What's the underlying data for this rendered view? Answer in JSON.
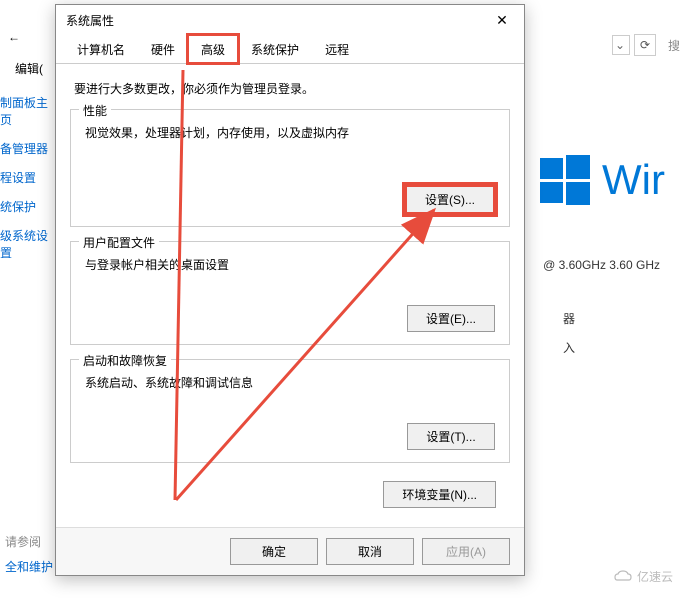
{
  "background": {
    "nav_back": "←",
    "edit_label": "编辑(",
    "sidebar": [
      "制面板主页",
      "备管理器",
      "程设置",
      "统保护",
      "级系统设置"
    ],
    "dropdown_chevron": "⌄",
    "refresh_icon": "⟳",
    "search_placeholder": "搜",
    "windows_text": "Wir",
    "cpu_info": "@ 3.60GHz   3.60 GHz",
    "info_1": "器",
    "info_2": "入",
    "bottom_links": [
      "请参阅",
      "全和维护"
    ],
    "watermark": "亿速云"
  },
  "dialog": {
    "title": "系统属性",
    "close": "✕",
    "tabs": [
      "计算机名",
      "硬件",
      "高级",
      "系统保护",
      "远程"
    ],
    "active_tab_index": 2,
    "intro": "要进行大多数更改，你必须作为管理员登录。",
    "performance": {
      "title": "性能",
      "desc": "视觉效果，处理器计划，内存使用，以及虚拟内存",
      "button": "设置(S)..."
    },
    "userprofile": {
      "title": "用户配置文件",
      "desc": "与登录帐户相关的桌面设置",
      "button": "设置(E)..."
    },
    "startup": {
      "title": "启动和故障恢复",
      "desc": "系统启动、系统故障和调试信息",
      "button": "设置(T)..."
    },
    "env_button": "环境变量(N)...",
    "actions": {
      "ok": "确定",
      "cancel": "取消",
      "apply": "应用(A)"
    }
  },
  "colors": {
    "highlight": "#e74c3c",
    "win_blue": "#0078d7"
  }
}
